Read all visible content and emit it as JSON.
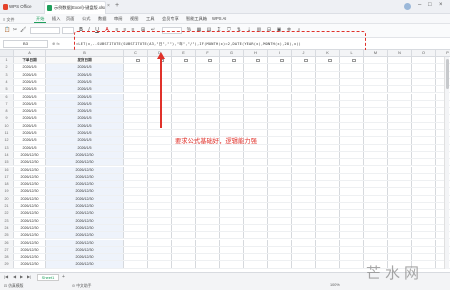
{
  "titlebar": {
    "app_name": "WPS Office",
    "doc_tab": "示例数据(Excel)-键盘版.xlsx",
    "close_glyph": "×",
    "new_tab_glyph": "+",
    "win_min": "–",
    "win_max": "□",
    "win_close": "×"
  },
  "menubar": {
    "left_label": "≡ 文件",
    "items": [
      "开始",
      "插入",
      "页面",
      "公式",
      "数据",
      "审阅",
      "视图",
      "工具",
      "会员专享",
      "智能工具箱",
      "WPS AI"
    ],
    "active_index": 0
  },
  "formula": {
    "cell_ref": "B3",
    "fx_label": "⊕ fx",
    "text": "=LET(x,--SUBSTITUTE(SUBSTITUTE(A3,\"日\",\"\"),\"年\",\"/\"),IF(MONTH(x)=2,DATE(YEAR(x),MONTH(x),28),x))"
  },
  "columns": [
    "A",
    "B",
    "C",
    "D",
    "E",
    "F",
    "G",
    "H",
    "I",
    "J",
    "K",
    "L",
    "M",
    "N",
    "O",
    "P"
  ],
  "table": {
    "header_a": "下单日期",
    "header_b": "发货日期",
    "rows": [
      [
        "2026/1/5",
        "2026/1/5"
      ],
      [
        "2026/1/5",
        "2026/1/5"
      ],
      [
        "2026/1/5",
        "2026/1/5"
      ],
      [
        "2026/1/5",
        "2026/1/5"
      ],
      [
        "2026/1/5",
        "2026/1/5"
      ],
      [
        "2026/1/5",
        "2026/1/5"
      ],
      [
        "2026/1/5",
        "2026/1/5"
      ],
      [
        "2026/1/5",
        "2026/1/5"
      ],
      [
        "2026/1/5",
        "2026/1/5"
      ],
      [
        "2026/1/5",
        "2026/1/5"
      ],
      [
        "2026/1/5",
        "2026/1/5"
      ],
      [
        "2026/1/5",
        "2026/1/5"
      ],
      [
        "2026/12/30",
        "2026/12/30"
      ],
      [
        "2026/12/30",
        "2026/12/30"
      ],
      [
        "2026/12/30",
        "2026/12/30"
      ],
      [
        "2026/12/30",
        "2026/12/30"
      ],
      [
        "2026/12/30",
        "2026/12/30"
      ],
      [
        "2026/12/30",
        "2026/12/30"
      ],
      [
        "2026/12/30",
        "2026/12/30"
      ],
      [
        "2026/12/30",
        "2026/12/30"
      ],
      [
        "2026/12/30",
        "2026/12/30"
      ],
      [
        "2026/12/30",
        "2026/12/30"
      ],
      [
        "2026/12/30",
        "2026/12/30"
      ],
      [
        "2026/12/30",
        "2026/12/30"
      ],
      [
        "2026/12/30",
        "2026/12/30"
      ],
      [
        "2026/12/30",
        "2026/12/30"
      ],
      [
        "2026/12/30",
        "2026/12/30"
      ],
      [
        "2026/12/30",
        "2026/12/30"
      ]
    ]
  },
  "annotation": "要求公式基础好，逻辑能力强",
  "bottom": {
    "sheet_tab": "Sheet1",
    "add_sheet": "+",
    "status_left": "⊡ 仿真模版",
    "status_mid": "⊙ 中文助手",
    "zoom": "100%"
  },
  "watermark": "芒水网",
  "colors": {
    "accent": "#1e9f5b",
    "annotation_red": "#e0312a"
  }
}
